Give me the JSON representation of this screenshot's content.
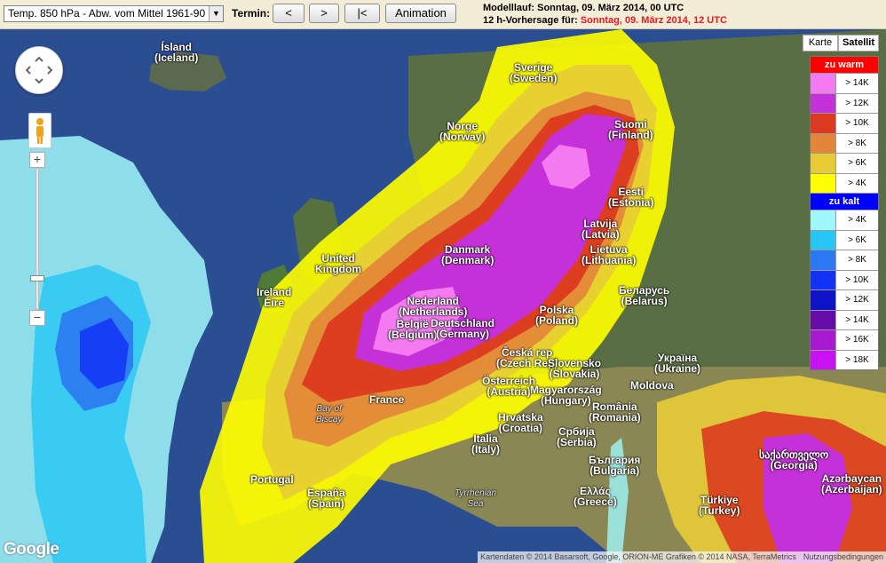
{
  "toolbar": {
    "dataset_select": "Temp. 850 hPa - Abw. vom Mittel 1961-90",
    "termin_label": "Termin:",
    "prev_label": "<",
    "next_label": ">",
    "first_label": "|<",
    "animation_label": "Animation",
    "modelllauf_label": "Modelllauf:",
    "modelllauf_value": "Sonntag, 09. März 2014, 00 UTC",
    "forecast_label": "12 h-Vorhersage für:",
    "forecast_value": "Sonntag, 09. März 2014, 12 UTC"
  },
  "map_type": {
    "karte": "Karte",
    "satellit": "Satellit",
    "selected": "Satellit"
  },
  "legend": {
    "warm_header": "zu warm",
    "cold_header": "zu kalt",
    "warm": [
      {
        "label": "> 14K",
        "color": "#f37af0"
      },
      {
        "label": "> 12K",
        "color": "#c531d8"
      },
      {
        "label": "> 10K",
        "color": "#dc3a1f"
      },
      {
        "label": "> 8K",
        "color": "#e3853a"
      },
      {
        "label": "> 6K",
        "color": "#e7cc36"
      },
      {
        "label": "> 4K",
        "color": "#ffff00"
      }
    ],
    "cold": [
      {
        "label": "> 4K",
        "color": "#9ff7fa"
      },
      {
        "label": "> 6K",
        "color": "#26c7f5"
      },
      {
        "label": "> 8K",
        "color": "#2c78f0"
      },
      {
        "label": "> 10K",
        "color": "#1232f6"
      },
      {
        "label": "> 12K",
        "color": "#0d13c8"
      },
      {
        "label": "> 14K",
        "color": "#660aa8"
      },
      {
        "label": "> 16K",
        "color": "#a71ad0"
      },
      {
        "label": "> 18K",
        "color": "#c812f1"
      }
    ]
  },
  "places": {
    "island": [
      "Ísland",
      "(Iceland)"
    ],
    "sverige": [
      "Sverige",
      "(Sweden)"
    ],
    "norge": [
      "Norge",
      "(Norway)"
    ],
    "suomi": [
      "Suomi",
      "(Finland)"
    ],
    "eesti": [
      "Eesti",
      "(Estonia)"
    ],
    "latvija": [
      "Latvija",
      "(Latvia)"
    ],
    "lietuva": [
      "Lietuva",
      "(Lithuania)"
    ],
    "danmark": [
      "Danmark",
      "(Denmark)"
    ],
    "uk": [
      "United",
      "Kingdom"
    ],
    "ireland": [
      "Ireland",
      "Éire"
    ],
    "nederland": [
      "Nederland",
      "(Netherlands)"
    ],
    "belgie": [
      "België",
      "(Belgium)"
    ],
    "deutschland": [
      "Deutschland",
      "(Germany)"
    ],
    "polska": [
      "Polska",
      "(Poland)"
    ],
    "belarus": [
      "Беларусь",
      "(Belarus)"
    ],
    "ukraina": [
      "Україна",
      "(Ukraine)"
    ],
    "ceska": [
      "Česká rep",
      "(Czech Rep)"
    ],
    "slovensko": [
      "Slovensko",
      "(Slovakia)"
    ],
    "osterreich": [
      "Österreich",
      "(Austria)"
    ],
    "magyar": [
      "Magyarország",
      "(Hungary)"
    ],
    "moldova": [
      "Moldova",
      ""
    ],
    "france": [
      "France",
      ""
    ],
    "hrvatska": [
      "Hrvatska",
      "(Croatia)"
    ],
    "romania": [
      "România",
      "(Romania)"
    ],
    "srbija": [
      "Србија",
      "(Serbia)"
    ],
    "bulgaria": [
      "България",
      "(Bulgaria)"
    ],
    "italia": [
      "Italia",
      "(Italy)"
    ],
    "portugal": [
      "Portugal",
      ""
    ],
    "espana": [
      "España",
      "(Spain)"
    ],
    "ellas": [
      "Ελλάς",
      "(Greece)"
    ],
    "turkiye": [
      "Türkiye",
      "(Turkey)"
    ],
    "georgia": [
      "საქართველო",
      "(Georgia)"
    ],
    "azerbaycan": [
      "Azərbaycan",
      "(Azerbaijan)"
    ],
    "bay_of_biscay": [
      "Bay of",
      "Biscay"
    ],
    "tyrrhenian": [
      "Tyrrhenian",
      "Sea"
    ]
  },
  "logo": "Google",
  "attribution": {
    "text": "Kartendaten © 2014 Basarsoft, Google, ORION-ME Grafiken © 2014 NASA, TerraMetrics",
    "terms": "Nutzungsbedingungen"
  }
}
